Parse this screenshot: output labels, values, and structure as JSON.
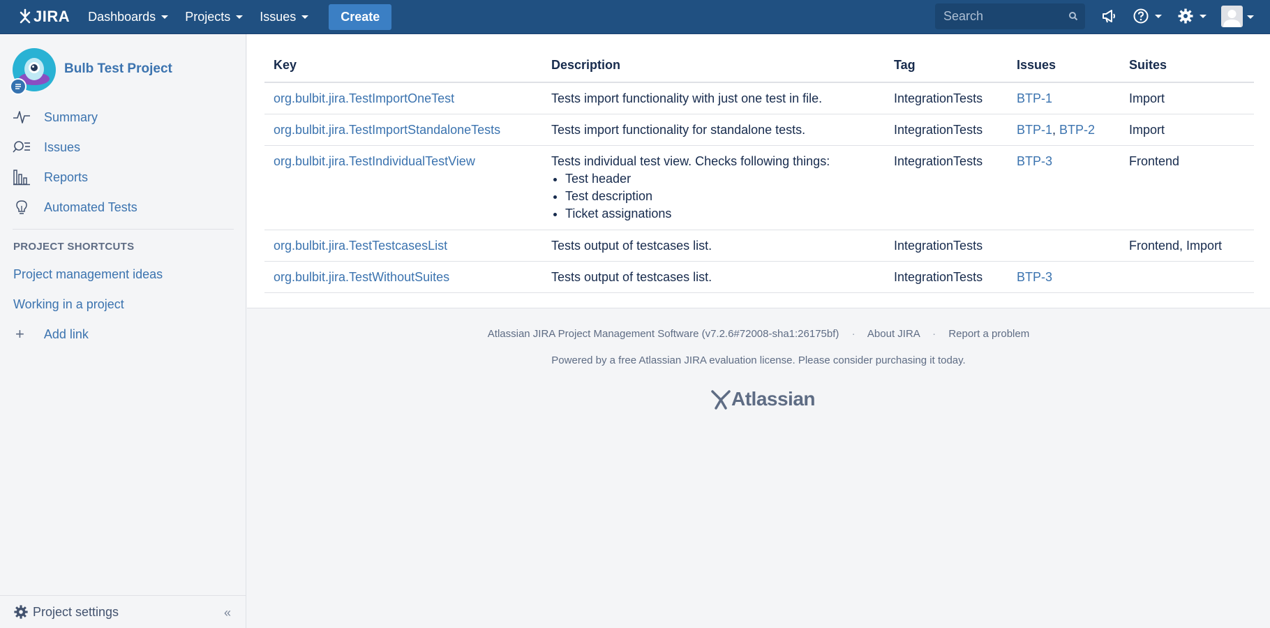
{
  "nav": {
    "logo_text": "JIRA",
    "menus": [
      "Dashboards",
      "Projects",
      "Issues"
    ],
    "create_label": "Create",
    "search_placeholder": "Search"
  },
  "sidebar": {
    "project_name": "Bulb Test Project",
    "items": [
      {
        "label": "Summary",
        "icon": "activity-icon"
      },
      {
        "label": "Issues",
        "icon": "issues-icon"
      },
      {
        "label": "Reports",
        "icon": "reports-icon"
      },
      {
        "label": "Automated Tests",
        "icon": "lightbulb-icon"
      }
    ],
    "shortcuts_heading": "PROJECT SHORTCUTS",
    "shortcuts": [
      "Project management ideas",
      "Working in a project"
    ],
    "add_link_label": "Add link",
    "settings_label": "Project settings",
    "collapse_label": "«"
  },
  "table": {
    "headers": [
      "Key",
      "Description",
      "Tag",
      "Issues",
      "Suites"
    ],
    "rows": [
      {
        "key": "org.bulbit.jira.TestImportOneTest",
        "description": "Tests import functionality with just one test in file.",
        "tag": "IntegrationTests",
        "issues": [
          "BTP-1"
        ],
        "suites": "Import"
      },
      {
        "key": "org.bulbit.jira.TestImportStandaloneTests",
        "description": "Tests import functionality for standalone tests.",
        "tag": "IntegrationTests",
        "issues": [
          "BTP-1",
          "BTP-2"
        ],
        "suites": "Import"
      },
      {
        "key": "org.bulbit.jira.TestIndividualTestView",
        "description": "Tests individual test view. Checks following things:",
        "bullets": [
          "Test header",
          "Test description",
          "Ticket assignations"
        ],
        "tag": "IntegrationTests",
        "issues": [
          "BTP-3"
        ],
        "suites": "Frontend"
      },
      {
        "key": "org.bulbit.jira.TestTestcasesList",
        "description": "Tests output of testcases list.",
        "tag": "IntegrationTests",
        "issues": [],
        "suites": "Frontend, Import"
      },
      {
        "key": "org.bulbit.jira.TestWithoutSuites",
        "description": "Tests output of testcases list.",
        "tag": "IntegrationTests",
        "issues": [
          "BTP-3"
        ],
        "suites": ""
      }
    ]
  },
  "footer": {
    "software": "Atlassian JIRA Project Management Software (v7.2.6#72008-sha1:26175bf)",
    "about": "About JIRA",
    "report": "Report a problem",
    "license": "Powered by a free Atlassian JIRA evaluation license. Please consider purchasing it today.",
    "brand": "Atlassian"
  },
  "colors": {
    "nav_bg": "#205081",
    "link": "#3b73af",
    "create_btn": "#3b7fc4"
  }
}
